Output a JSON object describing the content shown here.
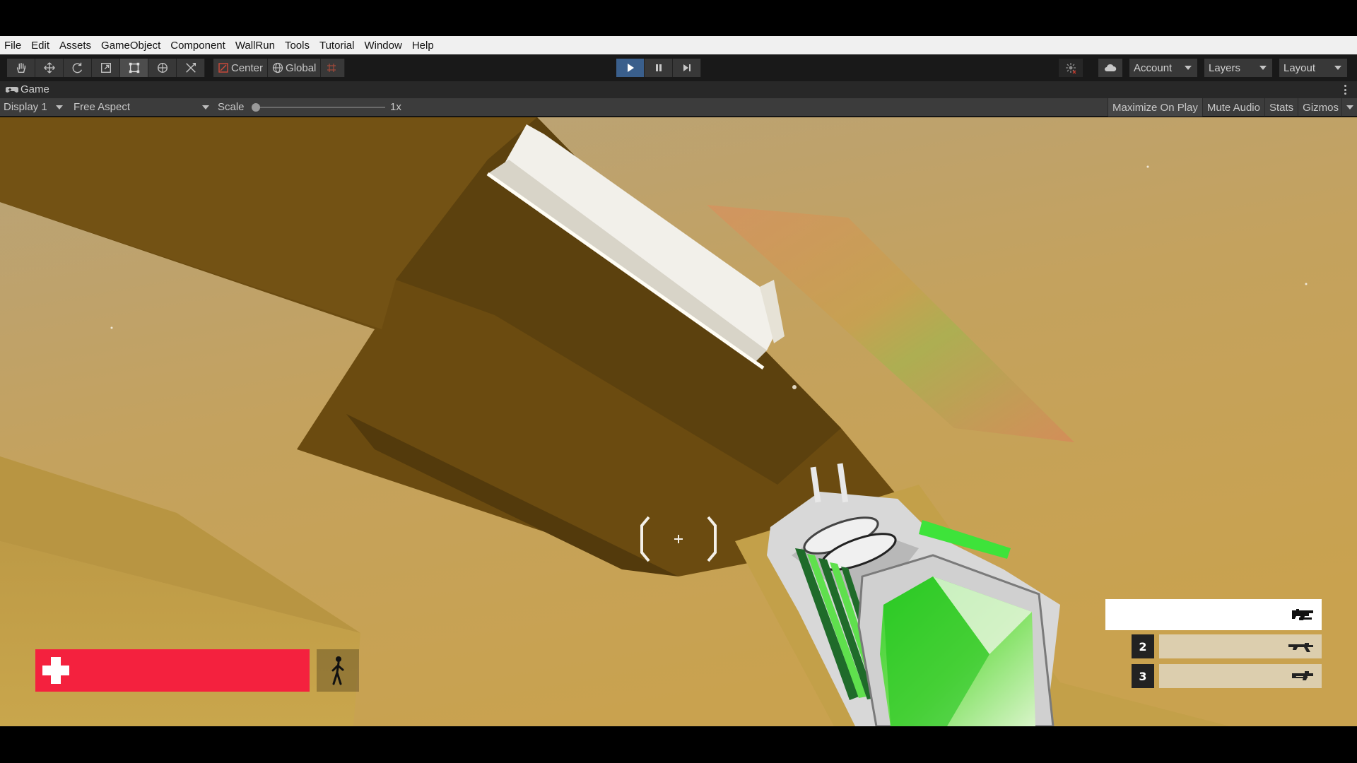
{
  "menubar": {
    "items": [
      "File",
      "Edit",
      "Assets",
      "GameObject",
      "Component",
      "WallRun",
      "Tools",
      "Tutorial",
      "Window",
      "Help"
    ]
  },
  "toolbar": {
    "tools": [
      "hand-tool-icon",
      "move-tool-icon",
      "rotate-tool-icon",
      "scale-tool-icon",
      "rect-tool-icon",
      "transform-tool-icon",
      "custom-tool-icon"
    ],
    "pivot_mode": "Center",
    "pivot_rotation": "Global",
    "play_active": true,
    "account_label": "Account",
    "layers_label": "Layers",
    "layout_label": "Layout"
  },
  "game_tab": {
    "label": "Game"
  },
  "game_bar": {
    "display": "Display 1",
    "aspect": "Free Aspect",
    "scale_label": "Scale",
    "scale_value": "1x",
    "maximize_on_play": "Maximize On Play",
    "mute_audio": "Mute Audio",
    "stats": "Stats",
    "gizmos": "Gizmos"
  },
  "hud": {
    "health_fraction": 1.0,
    "health_color": "#f4213e",
    "weapon_slots": [
      {
        "number": "",
        "active": true,
        "icon": "shotgun-icon"
      },
      {
        "number": "2",
        "active": false,
        "icon": "rifle-icon"
      },
      {
        "number": "3",
        "active": false,
        "icon": "smg-icon"
      }
    ]
  },
  "colors": {
    "sky": "#c9a760",
    "wall_dark": "#6b4c12",
    "accent_green": "#3bd63b",
    "play_blue": "#3a5f8c"
  }
}
